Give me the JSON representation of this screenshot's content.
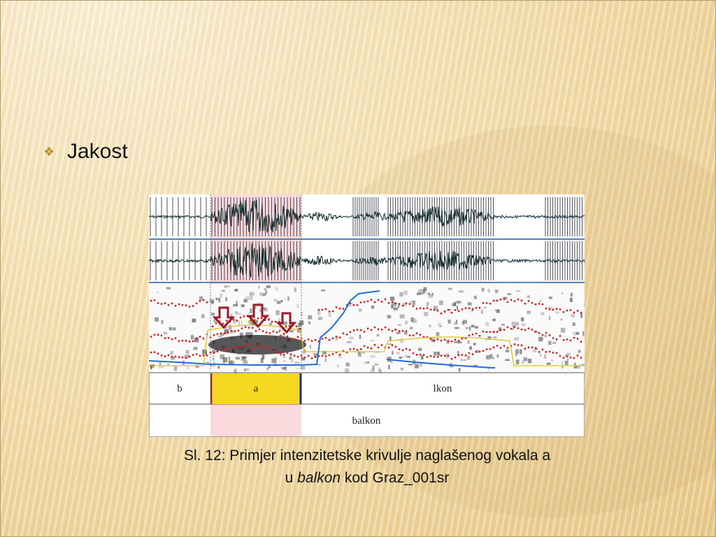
{
  "slide": {
    "bullet": {
      "icon": "four-point-star-icon",
      "text": "Jakost"
    },
    "caption": {
      "line1": "Sl. 12: Primjer intenzitetske krivulje naglašenog vokala a",
      "line2_prefix": "u ",
      "line2_italic": "balkon",
      "line2_suffix": " kod Graz_001sr"
    },
    "figure": {
      "segment_tier": [
        "b",
        "a",
        "lkon"
      ],
      "word_tier": [
        "balkon"
      ]
    },
    "colors": {
      "highlight": "#fadadd",
      "segment_selected": "#f5d81f",
      "arrow": "#9a1a2a",
      "pitch": "#1f6fd6",
      "formant": "#d22020",
      "intensity": "#e0c020"
    }
  }
}
